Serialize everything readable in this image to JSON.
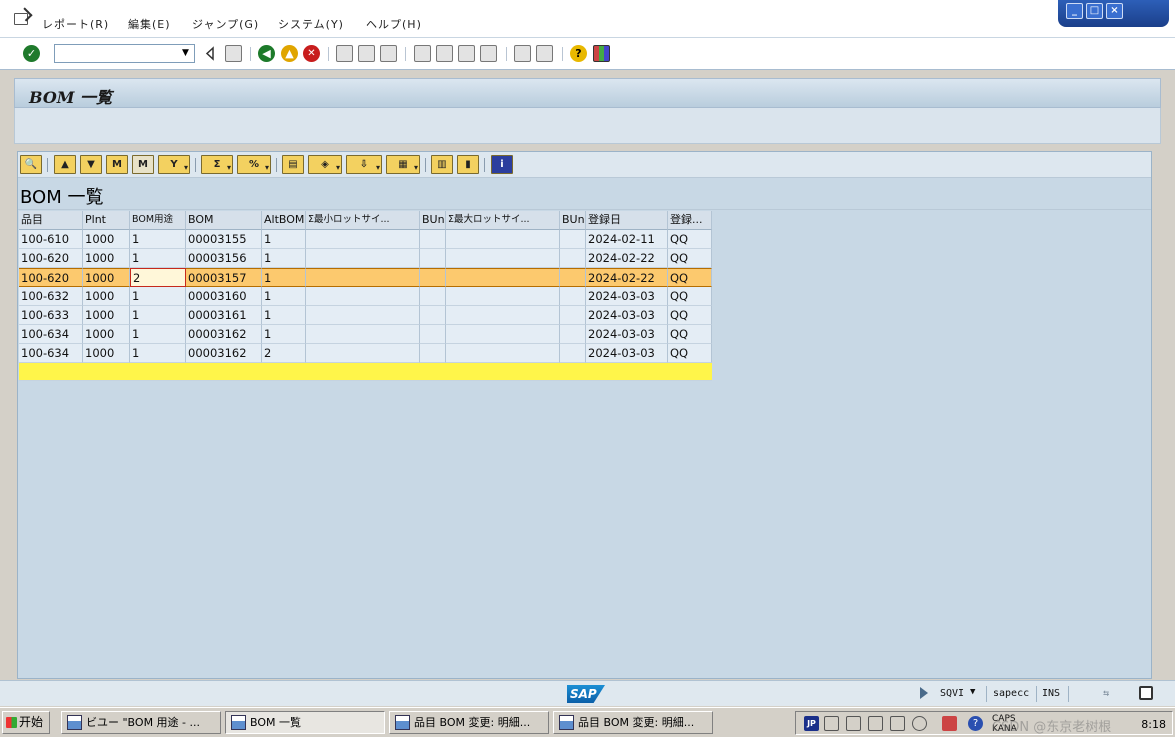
{
  "menu": {
    "items": [
      "レポート(R)",
      "編集(E)",
      "ジャンプ(G)",
      "システム(Y)",
      "ヘルプ(H)"
    ]
  },
  "window_controls": [
    "_",
    "□",
    "×"
  ],
  "toolbar": {
    "command_field_value": "",
    "icons": [
      "ok-icon",
      "save-icon",
      "back-icon",
      "exit-icon",
      "cancel-icon",
      "print-icon",
      "find-icon",
      "find-next-icon",
      "first-page-icon",
      "previous-page-icon",
      "next-page-icon",
      "last-page-icon",
      "new-session-icon",
      "shortcut-icon",
      "help-icon",
      "layout-icon"
    ]
  },
  "title": "BOM 一覧",
  "list": {
    "title": "BOM 一覧",
    "columns": [
      "品目",
      "Plnt",
      "BOM用途",
      "BOM",
      "AltBOM",
      "Σ最小ロットサイ...",
      "BUn",
      "Σ最大ロットサイ...",
      "BUn",
      "登録日",
      "登録..."
    ],
    "rows": [
      [
        "100-610",
        "1000",
        "1",
        "00003155",
        "1",
        "",
        "",
        "",
        "",
        "2024-02-11",
        "QQ"
      ],
      [
        "100-620",
        "1000",
        "1",
        "00003156",
        "1",
        "",
        "",
        "",
        "",
        "2024-02-22",
        "QQ"
      ],
      [
        "100-620",
        "1000",
        "2",
        "00003157",
        "1",
        "",
        "",
        "",
        "",
        "2024-02-22",
        "QQ"
      ],
      [
        "100-632",
        "1000",
        "1",
        "00003160",
        "1",
        "",
        "",
        "",
        "",
        "2024-03-03",
        "QQ"
      ],
      [
        "100-633",
        "1000",
        "1",
        "00003161",
        "1",
        "",
        "",
        "",
        "",
        "2024-03-03",
        "QQ"
      ],
      [
        "100-634",
        "1000",
        "1",
        "00003162",
        "1",
        "",
        "",
        "",
        "",
        "2024-03-03",
        "QQ"
      ],
      [
        "100-634",
        "1000",
        "1",
        "00003162",
        "2",
        "",
        "",
        "",
        "",
        "2024-03-03",
        "QQ"
      ]
    ],
    "selected_row": 2
  },
  "status": {
    "logo": "SAP",
    "transaction": "SQVI",
    "server": "sapecc",
    "mode": "INS"
  },
  "taskbar": {
    "start_label": "开始",
    "tasks": [
      "ビユー \"BOM 用途 - ...",
      "BOM 一覧",
      "品目 BOM 変更: 明細...",
      "品目 BOM 変更: 明細..."
    ],
    "active_task": 1,
    "tray": {
      "ime": "JP",
      "caps": "CAPS",
      "kana": "KANA",
      "clock": "8:18",
      "watermark": "CSDN @东京老树根"
    }
  },
  "colors": {
    "selected_row": "#fcc96e",
    "sum_row": "#fff54a",
    "grid_cell": "#e4edf5",
    "title_bar": "#c9d9e6"
  }
}
